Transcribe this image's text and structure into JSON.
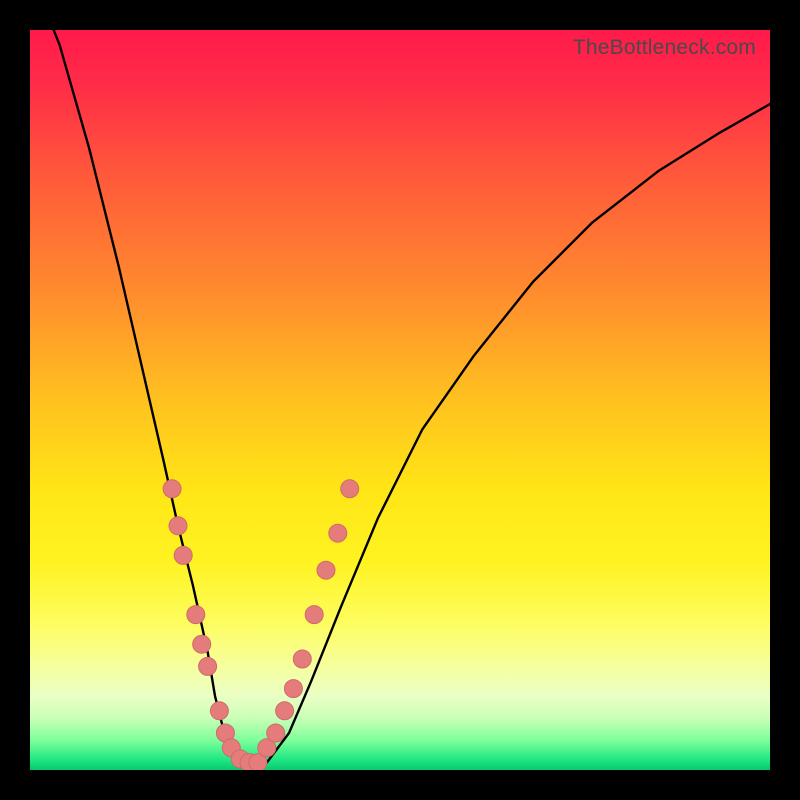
{
  "watermark": "TheBottleneck.com",
  "colors": {
    "frame": "#000000",
    "curve": "#000000",
    "points_fill": "#e47c7c",
    "points_stroke": "#d06a6a",
    "gradient_stops": [
      {
        "offset": 0.0,
        "color": "#ff1a4b"
      },
      {
        "offset": 0.08,
        "color": "#ff2e47"
      },
      {
        "offset": 0.2,
        "color": "#ff5a3a"
      },
      {
        "offset": 0.35,
        "color": "#ff8a2e"
      },
      {
        "offset": 0.5,
        "color": "#ffc11f"
      },
      {
        "offset": 0.62,
        "color": "#ffe516"
      },
      {
        "offset": 0.72,
        "color": "#fff322"
      },
      {
        "offset": 0.8,
        "color": "#fdfd5e"
      },
      {
        "offset": 0.86,
        "color": "#f6ff9e"
      },
      {
        "offset": 0.9,
        "color": "#eaffc4"
      },
      {
        "offset": 0.93,
        "color": "#c9ffb7"
      },
      {
        "offset": 0.96,
        "color": "#7dff9a"
      },
      {
        "offset": 0.985,
        "color": "#22e884"
      },
      {
        "offset": 1.0,
        "color": "#06c96f"
      }
    ]
  },
  "chart_data": {
    "type": "line",
    "title": "",
    "xlabel": "",
    "ylabel": "",
    "xlim": [
      0,
      100
    ],
    "ylim": [
      0,
      100
    ],
    "series": [
      {
        "name": "bottleneck-curve",
        "x": [
          0,
          4,
          8,
          12,
          15,
          18,
          20,
          22,
          24,
          25,
          26,
          27,
          28,
          30,
          32,
          35,
          38,
          42,
          47,
          53,
          60,
          68,
          76,
          85,
          93,
          100
        ],
        "y": [
          108,
          98,
          84,
          68,
          55,
          42,
          33,
          25,
          16,
          10,
          6,
          3,
          1,
          0.5,
          1,
          5,
          12,
          22,
          34,
          46,
          56,
          66,
          74,
          81,
          86,
          90
        ]
      }
    ],
    "points": [
      {
        "name": "p1",
        "x": 19.2,
        "y": 38
      },
      {
        "name": "p2",
        "x": 20.0,
        "y": 33
      },
      {
        "name": "p3",
        "x": 20.7,
        "y": 29
      },
      {
        "name": "p4",
        "x": 22.4,
        "y": 21
      },
      {
        "name": "p5",
        "x": 23.2,
        "y": 17
      },
      {
        "name": "p6",
        "x": 24.0,
        "y": 14
      },
      {
        "name": "p7",
        "x": 25.6,
        "y": 8
      },
      {
        "name": "p8",
        "x": 26.4,
        "y": 5
      },
      {
        "name": "p9",
        "x": 27.2,
        "y": 3
      },
      {
        "name": "p10",
        "x": 28.4,
        "y": 1.5
      },
      {
        "name": "p11",
        "x": 29.6,
        "y": 1
      },
      {
        "name": "p12",
        "x": 30.8,
        "y": 1
      },
      {
        "name": "p13",
        "x": 32.0,
        "y": 3
      },
      {
        "name": "p14",
        "x": 33.2,
        "y": 5
      },
      {
        "name": "p15",
        "x": 34.4,
        "y": 8
      },
      {
        "name": "p16",
        "x": 35.6,
        "y": 11
      },
      {
        "name": "p17",
        "x": 36.8,
        "y": 15
      },
      {
        "name": "p18",
        "x": 38.4,
        "y": 21
      },
      {
        "name": "p19",
        "x": 40.0,
        "y": 27
      },
      {
        "name": "p20",
        "x": 41.6,
        "y": 32
      },
      {
        "name": "p21",
        "x": 43.2,
        "y": 38
      }
    ]
  }
}
